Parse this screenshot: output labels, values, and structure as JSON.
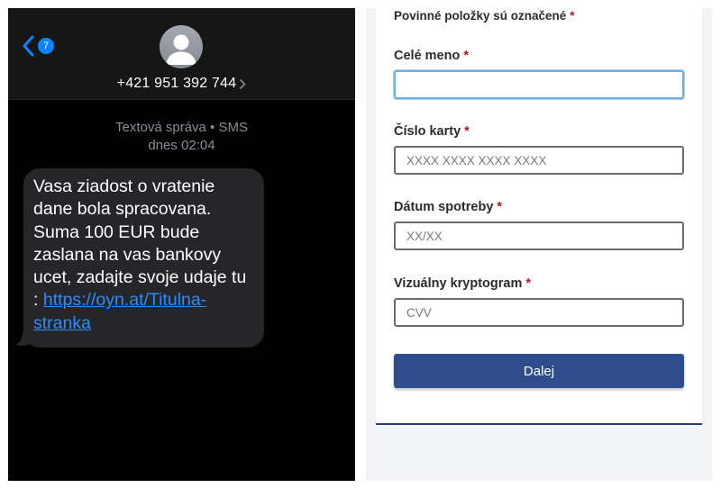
{
  "sms": {
    "unread_count": "7",
    "sender": "+421 951 392 744",
    "meta_type": "Textová správa • SMS",
    "meta_time": "dnes 02:04",
    "message_text": "Vasa ziadost o vratenie dane bola spracovana. Suma 100 EUR bude zaslana na vas bankovy ucet, zadajte svoje udaje tu : ",
    "message_link": "https://oyn.at/Titulna-stranka",
    "colors": {
      "bubble": "#262628",
      "link": "#2b8cff",
      "badge": "#0a84ff"
    }
  },
  "form": {
    "required_note": "Povinné položky sú označené",
    "required_star": "*",
    "fields": [
      {
        "label": "Celé meno",
        "placeholder": "",
        "value": ""
      },
      {
        "label": "Číslo karty",
        "placeholder": "XXXX XXXX XXXX XXXX",
        "value": ""
      },
      {
        "label": "Dátum spotreby",
        "placeholder": "XX/XX",
        "value": ""
      },
      {
        "label": "Vizuálny kryptogram",
        "placeholder": "CVV",
        "value": ""
      }
    ],
    "submit_label": "Dalej",
    "colors": {
      "button": "#2f4c8f",
      "star": "#c0151b",
      "focus": "#6fb1e6"
    }
  }
}
